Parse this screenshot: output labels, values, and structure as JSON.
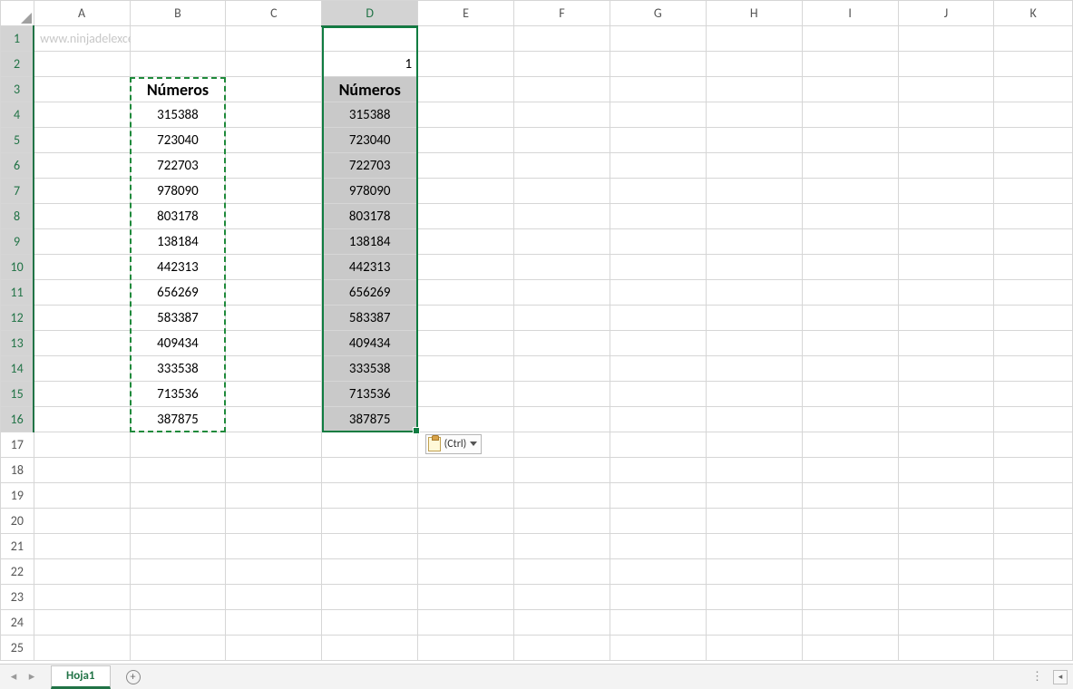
{
  "watermark": "www.ninjadelexcel.com",
  "columns": [
    "A",
    "B",
    "C",
    "D",
    "E",
    "F",
    "G",
    "H",
    "I",
    "J",
    "K"
  ],
  "row_count": 25,
  "active_column_index": 3,
  "active_row_start": 1,
  "active_row_end": 16,
  "cells": {
    "D2": "1"
  },
  "table_b": {
    "header": "Números",
    "values": [
      "315388",
      "723040",
      "722703",
      "978090",
      "803178",
      "138184",
      "442313",
      "656269",
      "583387",
      "409434",
      "333538",
      "713536",
      "387875"
    ]
  },
  "table_d": {
    "header": "Números",
    "values": [
      "315388",
      "723040",
      "722703",
      "978090",
      "803178",
      "138184",
      "442313",
      "656269",
      "583387",
      "409434",
      "333538",
      "713536",
      "387875"
    ]
  },
  "paste_options_label": "(Ctrl)",
  "sheet_tab": "Hoja1",
  "icons": {
    "nav_prev": "◂",
    "nav_next": "▸",
    "plus": "+",
    "caret_down": "▾",
    "dots": "⋮",
    "left_arrow_small": "◂"
  }
}
